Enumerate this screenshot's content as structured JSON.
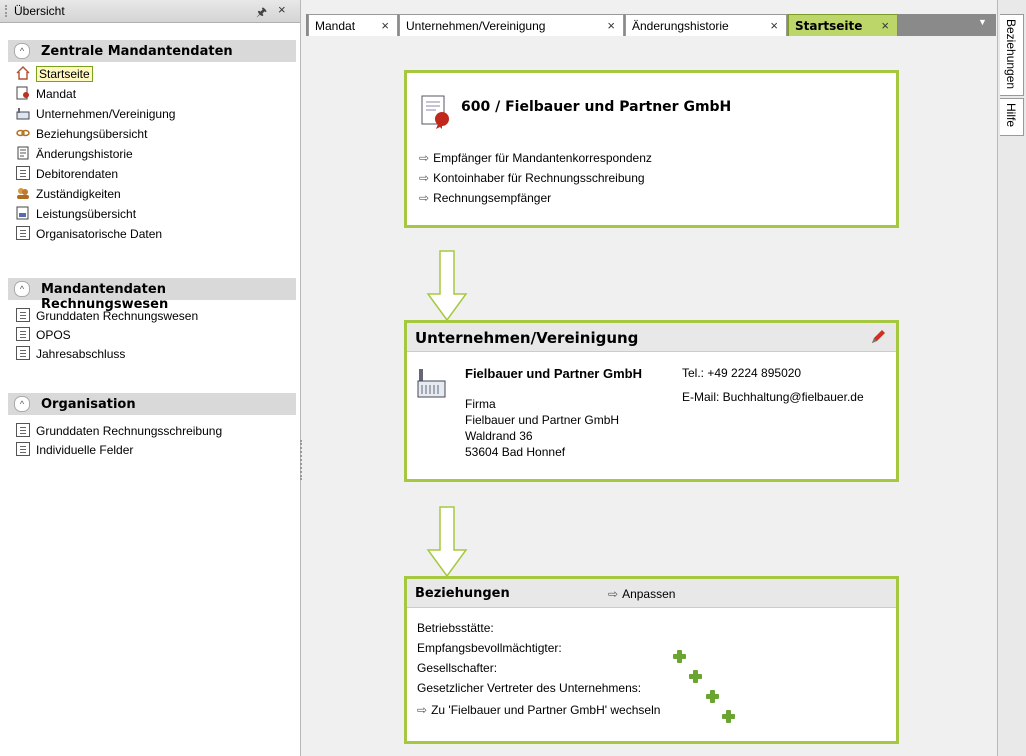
{
  "left_panel": {
    "title": "Übersicht",
    "pin_icon": "pin-icon",
    "close": "×",
    "sections": [
      {
        "title": "Zentrale Mandantendaten",
        "items": [
          "Startseite",
          "Mandat",
          "Unternehmen/Vereinigung",
          "Beziehungsübersicht",
          "Änderungshistorie",
          "Debitorendaten",
          "Zuständigkeiten",
          "Leistungsübersicht",
          "Organisatorische Daten"
        ]
      },
      {
        "title": "Mandantendaten Rechnungswesen",
        "items": [
          "Grunddaten Rechnungswesen",
          "OPOS",
          "Jahresabschluss"
        ]
      },
      {
        "title": "Organisation",
        "items": [
          "Grunddaten Rechnungsschreibung",
          "Individuelle Felder"
        ]
      }
    ],
    "selected_item": "Startseite"
  },
  "tabs": [
    {
      "label": "Mandat",
      "close": "×"
    },
    {
      "label": "Unternehmen/Vereinigung",
      "close": "×"
    },
    {
      "label": "Änderungshistorie",
      "close": "×"
    },
    {
      "label": "Startseite",
      "close": "×",
      "active": true
    }
  ],
  "card_mandat": {
    "title": "600 / Fielbauer und Partner GmbH",
    "links": [
      "Empfänger für Mandantenkorrespondenz",
      "Kontoinhaber für Rechnungsschreibung",
      "Rechnungsempfänger"
    ]
  },
  "card_unternehmen": {
    "title": "Unternehmen/Vereinigung",
    "company_name": "Fielbauer und Partner GmbH",
    "type": "Firma",
    "address_name": "Fielbauer und Partner GmbH",
    "street": "Waldrand 36",
    "city": "53604 Bad Honnef",
    "phone": "Tel.: +49 2224 895020",
    "email": "E-Mail: Buchhaltung@fielbauer.de"
  },
  "card_beziehungen": {
    "title": "Beziehungen",
    "customize": "Anpassen",
    "rows": [
      "Betriebsstätte:",
      "Empfangsbevollmächtigter:",
      "Gesellschafter:",
      "Gesetzlicher Vertreter des Unternehmens:"
    ],
    "switch_link": "Zu 'Fielbauer und Partner GmbH' wechseln"
  },
  "right_tabs": [
    "Beziehungen",
    "Hilfe"
  ],
  "arrow_glyph": "⇨",
  "colors": {
    "accent": "#a6c840",
    "active_tab": "#bcd66a"
  }
}
